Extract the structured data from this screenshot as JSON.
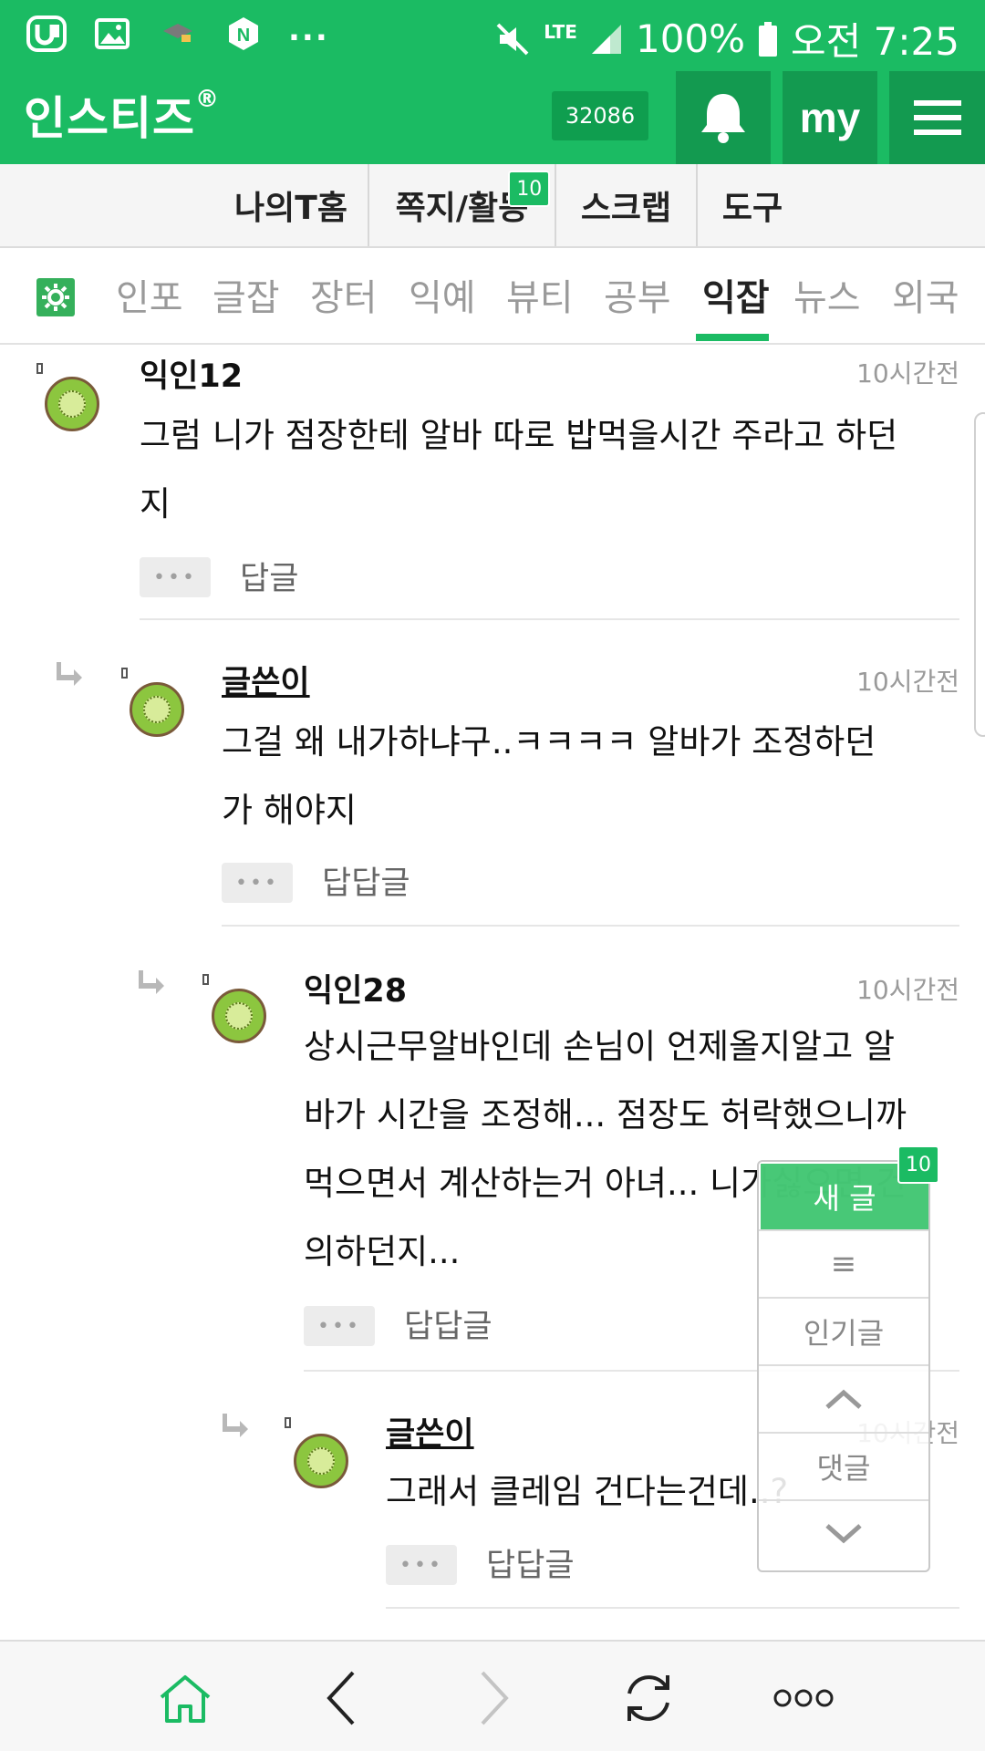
{
  "status_bar": {
    "notification_icons": [
      "u-plus-icon",
      "gallery-icon",
      "grad-cap-icon",
      "naver-icon"
    ],
    "more": "...",
    "network": "LTE",
    "battery": "100%",
    "time": "오전 7:25"
  },
  "header": {
    "logo": "인스티즈",
    "logo_mark": "®",
    "count": "32086",
    "my_label": "my"
  },
  "subtabs": [
    {
      "label": "나의T홈"
    },
    {
      "label": "쪽지/활동",
      "badge": "10"
    },
    {
      "label": "스크랩"
    },
    {
      "label": "도구"
    }
  ],
  "categories": [
    {
      "label": "인포"
    },
    {
      "label": "글잡"
    },
    {
      "label": "장터"
    },
    {
      "label": "익예"
    },
    {
      "label": "뷰티"
    },
    {
      "label": "공부"
    },
    {
      "label": "익잡"
    },
    {
      "label": "뉴스"
    },
    {
      "label": "외국"
    }
  ],
  "active_category": "익잡",
  "comments": [
    {
      "name": "익인12",
      "time": "10시간전",
      "body_lines": [
        "그럼 니가 점장한테 알바 따로 밥먹을시간 주라고 하던",
        "지"
      ],
      "action": "답글"
    },
    {
      "name": "글쓴이",
      "time": "10시간전",
      "body_lines": [
        "그걸 왜 내가하냐구..ㅋㅋㅋㅋ 알바가 조정하던",
        "가 해야지"
      ],
      "action": "답답글"
    },
    {
      "name": "익인28",
      "time": "10시간전",
      "body_lines": [
        "상시근무알바인데 손님이 언제올지알고 알",
        "바가 시간을 조정해... 점장도 허락했으니까",
        "먹으면서 계산하는거 아녀... 니가싫으면 건",
        "의하던지..."
      ],
      "action": "답답글"
    },
    {
      "name": "글쓴이",
      "time": "10시간전",
      "body_lines": [
        "그래서 클레임 건다는건데..?"
      ],
      "action": "답답글"
    }
  ],
  "more_dots": "•••",
  "float_panel": {
    "new_label": "새 글",
    "new_badge": "10",
    "list_icon": "≡",
    "popular": "인기글",
    "comments": "댓글"
  },
  "bottom_nav": [
    "home-icon",
    "back-icon",
    "forward-icon",
    "refresh-icon",
    "more-icon"
  ],
  "colors": {
    "brand_green": "#1bbb63",
    "dark_green": "#139a50",
    "muted_text": "#9a9a9a"
  }
}
